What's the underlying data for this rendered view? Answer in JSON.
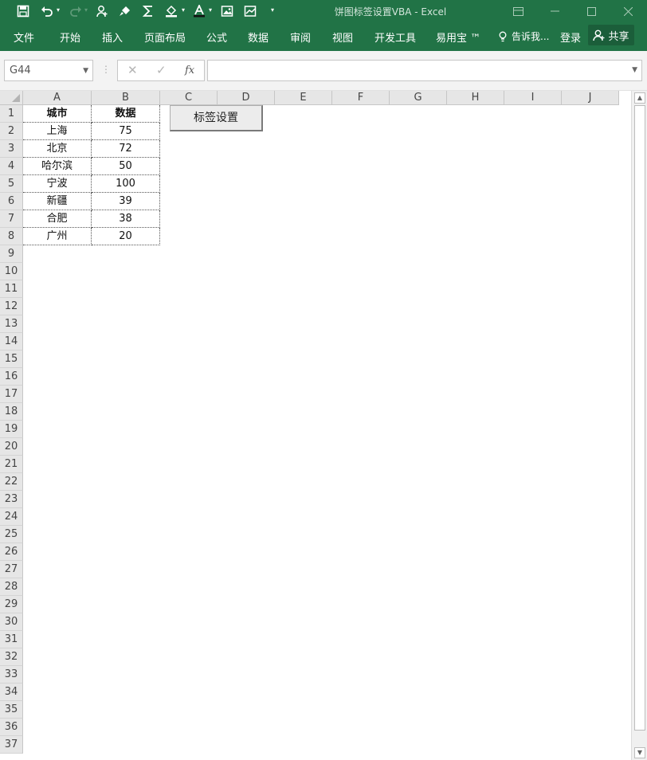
{
  "window": {
    "title": "饼图标签设置VBA - Excel",
    "min_icon": "minimize-icon",
    "max_icon": "maximize-icon",
    "close_icon": "close-icon",
    "restore_icon": "ribbon-display-icon"
  },
  "quick_access": [
    "save-icon",
    "undo-icon",
    "redo-icon",
    "person-add-icon",
    "brush-icon",
    "sum-icon",
    "fill-color-icon",
    "font-color-icon",
    "picture-icon",
    "chart-icon",
    "customize-icon"
  ],
  "ribbon": {
    "tabs": [
      "文件",
      "开始",
      "插入",
      "页面布局",
      "公式",
      "数据",
      "审阅",
      "视图",
      "开发工具",
      "易用宝 ™"
    ],
    "tell_me": "告诉我...",
    "login": "登录",
    "share": "共享"
  },
  "formula_bar": {
    "name_box": "G44",
    "cancel": "✕",
    "enter": "✓",
    "fx": "fx",
    "formula": ""
  },
  "sheet": {
    "columns": [
      "A",
      "B",
      "C",
      "D",
      "E",
      "F",
      "G",
      "H",
      "I",
      "J"
    ],
    "rows": [
      "1",
      "2",
      "3",
      "4",
      "5",
      "6",
      "7",
      "8",
      "9",
      "10",
      "11",
      "12",
      "13",
      "14",
      "15",
      "16",
      "17",
      "18",
      "19",
      "20",
      "21",
      "22",
      "23",
      "24",
      "25",
      "26",
      "27",
      "28",
      "29",
      "30",
      "31",
      "32",
      "33",
      "34",
      "35",
      "36",
      "37"
    ],
    "header": [
      "城市",
      "数据"
    ],
    "data": [
      [
        "上海",
        "75"
      ],
      [
        "北京",
        "72"
      ],
      [
        "哈尔滨",
        "50"
      ],
      [
        "宁波",
        "100"
      ],
      [
        "新疆",
        "39"
      ],
      [
        "合肥",
        "38"
      ],
      [
        "广州",
        "20"
      ]
    ],
    "button_label": "标签设置"
  }
}
